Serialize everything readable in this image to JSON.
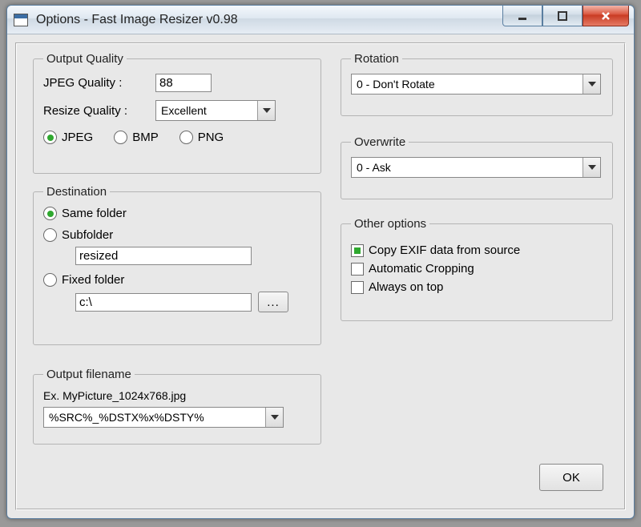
{
  "window": {
    "title": "Options - Fast Image Resizer v0.98"
  },
  "quality": {
    "legend": "Output Quality",
    "jpeg_quality_label": "JPEG Quality :",
    "jpeg_quality_value": "88",
    "resize_quality_label": "Resize Quality :",
    "resize_quality_value": "Excellent",
    "fmt_jpeg": "JPEG",
    "fmt_bmp": "BMP",
    "fmt_png": "PNG"
  },
  "destination": {
    "legend": "Destination",
    "same_folder": "Same folder",
    "subfolder": "Subfolder",
    "subfolder_value": "resized",
    "fixed_folder": "Fixed folder",
    "fixed_folder_value": "c:\\",
    "browse_label": "..."
  },
  "filename": {
    "legend": "Output filename",
    "example": "Ex. MyPicture_1024x768.jpg",
    "pattern": "%SRC%_%DSTX%x%DSTY%"
  },
  "rotation": {
    "legend": "Rotation",
    "value": "0 - Don't Rotate"
  },
  "overwrite": {
    "legend": "Overwrite",
    "value": "0 - Ask"
  },
  "other": {
    "legend": "Other options",
    "copy_exif": "Copy EXIF data from source",
    "auto_crop": "Automatic Cropping",
    "always_on_top": "Always on top"
  },
  "ok_label": "OK"
}
